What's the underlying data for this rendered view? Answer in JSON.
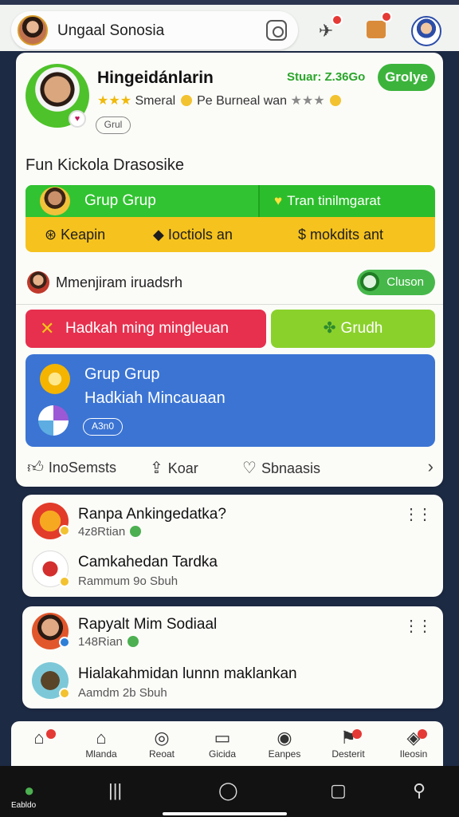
{
  "topbar": {
    "title": "Ungaal Sonosia",
    "icons": [
      "refresh-square-icon",
      "pin-icon",
      "bag-icon",
      "profile-icon"
    ]
  },
  "profile": {
    "name": "Hingeidánlarin",
    "stats": "Stuar: Z.36Go",
    "join_label": "Grolye",
    "rating_text_1": "Smeral",
    "rating_text_2": "Pe Burneal wan",
    "edit_label": "Grul"
  },
  "section": {
    "title": "Fun Kickola Drasosike"
  },
  "green_bar": {
    "left_label": "Grup Grup",
    "right_label": "Tran tinilmgarat"
  },
  "yellow_bar": {
    "items": [
      "Keapin",
      "Ioctiols an",
      "mokdits ant"
    ]
  },
  "message_row": {
    "text": "Mmenjiram iruadsrh",
    "button_label": "Cluson"
  },
  "red_button": {
    "label": "Hadkah ming mingleuan"
  },
  "lime_button": {
    "label": "Grudh"
  },
  "blue_card": {
    "title": "Grup Grup",
    "subtitle": "Hadkiah Mincauaan",
    "pill": "A3n0"
  },
  "actions": {
    "items": [
      "InoSemsts",
      "Koar",
      "Sbnaasis"
    ]
  },
  "list_cards": [
    {
      "title": "Ranpa Ankingedatka?",
      "sub": "4z8Rtian",
      "item_title": "Camkahedan Tardka",
      "item_sub": "Rammum 9o Sbuh"
    },
    {
      "title": "Rapyalt Mim Sodiaal",
      "sub": "148Rian",
      "item_title": "Hialakahmidan lunnn maklankan",
      "item_sub": "Aamdm 2b Sbuh"
    }
  ],
  "bottom_nav": {
    "items": [
      "",
      "Mlanda",
      "Reoat",
      "Gicida",
      "Eanpes",
      "Desterit",
      "Ileosin"
    ]
  },
  "system_bar": {
    "label": "Eabldo"
  },
  "colors": {
    "green": "#31c331",
    "yellow": "#f6c21e",
    "red": "#e6304e",
    "lime": "#8bd12c",
    "blue": "#3b74d3"
  }
}
